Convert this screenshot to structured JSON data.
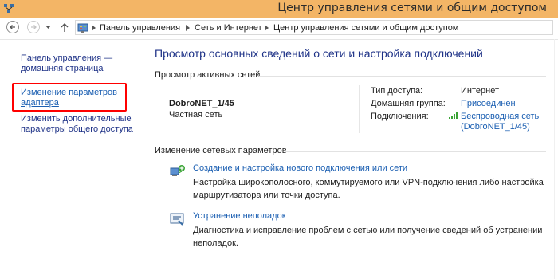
{
  "window": {
    "title": "Центр управления сетями и общим доступом",
    "title_bar_color": "#f3b566"
  },
  "address_bar": {
    "breadcrumbs": [
      "Панель управления",
      "Сеть и Интернет",
      "Центр управления сетями и общим доступом"
    ],
    "icons": [
      "back-arrow-icon",
      "forward-arrow-icon",
      "recent-dropdown-icon",
      "up-arrow-icon",
      "control-panel-icon",
      "chevron-right-icon"
    ]
  },
  "sidebar": {
    "items": [
      {
        "label_line1": "Панель управления —",
        "label_line2": "домашняя страница"
      },
      {
        "label_line1": "Изменение параметров",
        "label_line2": "адаптера",
        "highlighted": true,
        "highlight_color": "#ff0000"
      },
      {
        "label_line1": "Изменить дополнительные",
        "label_line2": "параметры общего доступа"
      }
    ]
  },
  "main": {
    "title": "Просмотр основных сведений о сети и настройка подключений",
    "active_networks": {
      "header": "Просмотр активных сетей",
      "network_name": "DobroNET_1/45",
      "network_category": "Частная сеть",
      "access_type_label": "Тип доступа:",
      "access_type_value": "Интернет",
      "homegroup_label": "Домашняя группа:",
      "homegroup_value": "Присоединен",
      "connections_label": "Подключения:",
      "connections_value_line1": "Беспроводная сеть",
      "connections_value_line2": "(DobroNET_1/45)",
      "connection_icon": "wifi-signal-icon"
    },
    "change_settings": {
      "header": "Изменение сетевых параметров",
      "tasks": [
        {
          "title": "Создание и настройка нового подключения или сети",
          "desc_line1": "Настройка широкополосного, коммутируемого или VPN-подключения либо настройка",
          "desc_line2": "маршрутизатора или точки доступа.",
          "icon": "new-connection-icon"
        },
        {
          "title": "Устранение неполадок",
          "desc_line1": "Диагностика и исправление проблем с сетью или получение сведений об устранении",
          "desc_line2": "неполадок.",
          "icon": "troubleshoot-icon"
        }
      ]
    }
  },
  "colors": {
    "link": "#1b5fb2",
    "heading": "#1e3287",
    "accent_title_bar": "#f3b566"
  }
}
